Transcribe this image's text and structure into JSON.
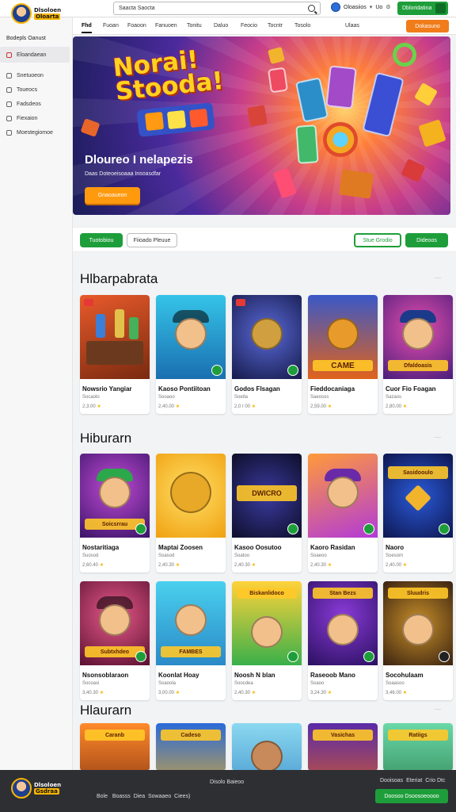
{
  "brand": {
    "line1": "Dlsoloen",
    "line2": "Oloarta"
  },
  "search": {
    "value": "Saacta Saocta"
  },
  "account": {
    "label": "Oloasiios",
    "lang": "Uo"
  },
  "header_button": "Dbloridatina",
  "nav": {
    "tabs": [
      "Fhd",
      "Fuoan",
      "Foaoon",
      "Fanuoen",
      "Tonitu",
      "Daluo",
      "Feocio",
      "Tocntr",
      "Tosolo",
      "Ulaas"
    ],
    "cta": "Dokasuno"
  },
  "sidebar": {
    "heading": "Bodepls Oanust",
    "items": [
      "Eloandaean",
      "Snetuoeon",
      "Toueocs",
      "Fadsdeos",
      "Fiexaion",
      "Moestegiomoe"
    ]
  },
  "hero": {
    "title_line1": "Norai!",
    "title_line2": "Stooda!",
    "subtitle": "Dloureo I nelapezis",
    "small": "Daas Doteoeisoaaa Insoasdfar",
    "button": "Gnaoaueon"
  },
  "filters": {
    "b1": "Tuotobiou",
    "b2": "Fiioado Pleuue",
    "b3": "Stue Grodio",
    "b4": "Dideoos"
  },
  "sections": [
    {
      "title": "Hlbarpabrata",
      "more": "...",
      "games": [
        {
          "name": "Nowsrio Yangiar",
          "prov": "Socaolo",
          "stat": "2,3.00",
          "thumb": ""
        },
        {
          "name": "Kaoso Pontiitoan",
          "prov": "Sooaoo",
          "stat": "2,40.00",
          "thumb": ""
        },
        {
          "name": "Godos Flsagan",
          "prov": "Soetla",
          "stat": "2,0 I 00",
          "thumb": ""
        },
        {
          "name": "Fieddocaniaga",
          "prov": "Saeosos",
          "stat": "2,59.00",
          "thumb": "CAME"
        },
        {
          "name": "Cuor Fio Foagan",
          "prov": "Sazaos",
          "stat": "2,80.00",
          "thumb": "Dfaldoasis"
        }
      ]
    },
    {
      "title": "Hiburarn",
      "more": "...",
      "games": [
        {
          "name": "Nostaritiaga",
          "prov": "Suosod",
          "stat": "2,60.40",
          "thumb": "Soicsrrau"
        },
        {
          "name": "Maptai Zoosen",
          "prov": "Soasod",
          "stat": "2,40.30",
          "thumb": ""
        },
        {
          "name": "Kasoo Oosutoo",
          "prov": "Soatoo",
          "stat": "2,40.30",
          "thumb": "DWICRO"
        },
        {
          "name": "Kaoro Rasidan",
          "prov": "Soaeoo",
          "stat": "2,40.30",
          "thumb": ""
        },
        {
          "name": "Naoro",
          "prov": "Soesom",
          "stat": "2,40.00",
          "thumb": "Sasidooulo"
        }
      ]
    },
    {
      "title": "",
      "more": "",
      "games": [
        {
          "name": "Nsonsoblaraon",
          "prov": "Socoasi",
          "stat": "3,40.30",
          "thumb": "Subtxhdeo"
        },
        {
          "name": "Koonlat Hoay",
          "prov": "Soaoola",
          "stat": "3,00.00",
          "thumb": "FAMBES"
        },
        {
          "name": "Noosh N blan",
          "prov": "Soocdea",
          "stat": "2,40.30",
          "thumb": "Biskanlidoco"
        },
        {
          "name": "Raseoob Mano",
          "prov": "Soaoo",
          "stat": "3,24.30",
          "thumb": "Stan Bezs"
        },
        {
          "name": "Socohulaam",
          "prov": "Soaasoo",
          "stat": "3,46.00",
          "thumb": "Sluudris"
        }
      ]
    },
    {
      "title": "Hlaurarn",
      "more": "...",
      "games": [
        {
          "thumb": "Caranb"
        },
        {
          "thumb": "Cadeso"
        },
        {
          "thumb": ""
        },
        {
          "thumb": "Vasichas"
        },
        {
          "thumb": "Ratiigs"
        }
      ]
    }
  ],
  "footer": {
    "brand_line1": "Dlsoloen",
    "brand_line2": "Gsdraa",
    "center_top": "Disolo Baieoo",
    "center_bottom": "Bole   Boasss  Diea  Sowaaeo  Ciees)",
    "right_top": "Dooisoas  Eteriat  Crio Dtc",
    "button": "Doosoo Dsoosoeoooo"
  },
  "colors": {
    "accent_green": "#1e9e3a",
    "accent_orange": "#f07c1a",
    "footer_bg": "#2d2f33"
  }
}
